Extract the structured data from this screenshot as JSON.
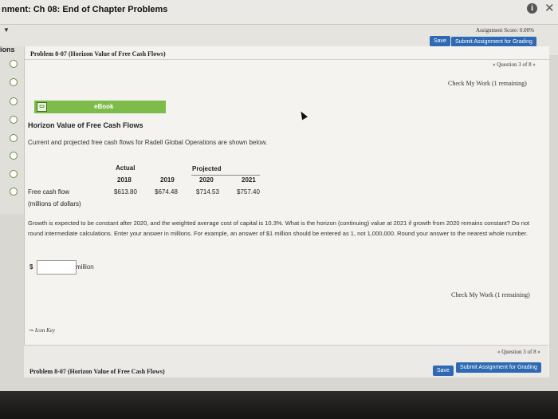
{
  "header": {
    "assignment_title": "nment: Ch 08: End of Chapter Problems",
    "score_label": "Assignment Score: 0.00%",
    "save_label": "Save",
    "submit_label": "Submit Assignment for Grading"
  },
  "sidebar": {
    "label": "ions"
  },
  "problem": {
    "title": "Problem 8-07 (Horizon Value of Free Cash Flows)",
    "question_nav": "« Question 3 of 8 »",
    "check_label_top": "Check My Work (1 remaining)",
    "check_label_bottom": "Check My Work (1 remaining)",
    "ebook_label": "eBook",
    "heading": "Horizon Value of Free Cash Flows",
    "description": "Current and projected free cash flows for Radell Global Operations are shown below."
  },
  "table": {
    "actual_label": "Actual",
    "projected_label": "Projected",
    "years": [
      "2018",
      "2019",
      "2020",
      "2021"
    ],
    "row_label": "Free cash flow",
    "row_sublabel": "(millions of dollars)",
    "values": [
      "$613.80",
      "$674.48",
      "$714.53",
      "$757.40"
    ]
  },
  "question": {
    "text": "Growth is expected to be constant after 2020, and the weighted average cost of capital is 10.3%. What is the horizon (continuing) value at 2021 if growth from 2020 remains constant? Do not round intermediate calculations. Enter your answer in millions. For example, an answer of $1 million should be entered as 1, not 1,000,000. Round your answer to the nearest whole number.",
    "currency": "$",
    "answer_value": "",
    "unit": "million"
  },
  "icon_key": {
    "label": "Icon Key"
  },
  "footer": {
    "problem_title": "Problem 8-07 (Horizon Value of Free Cash Flows)",
    "question_nav": "« Question 3 of 8 »",
    "save_label": "Save",
    "submit_label": "Submit Assignment for Grading"
  },
  "colors": {
    "button_blue": "#2f69b3",
    "ebook_green": "#7dbb4a",
    "radio_green": "#6b8e3f"
  }
}
